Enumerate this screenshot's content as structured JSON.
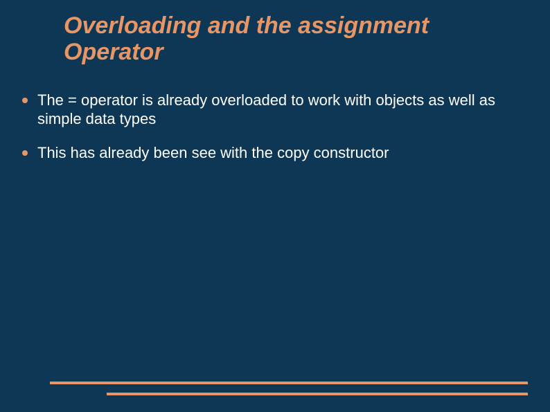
{
  "title": "Overloading and the assignment Operator",
  "bullets": [
    "The = operator is already overloaded to work with objects as well as simple data types",
    "This has already been see with the copy constructor"
  ]
}
